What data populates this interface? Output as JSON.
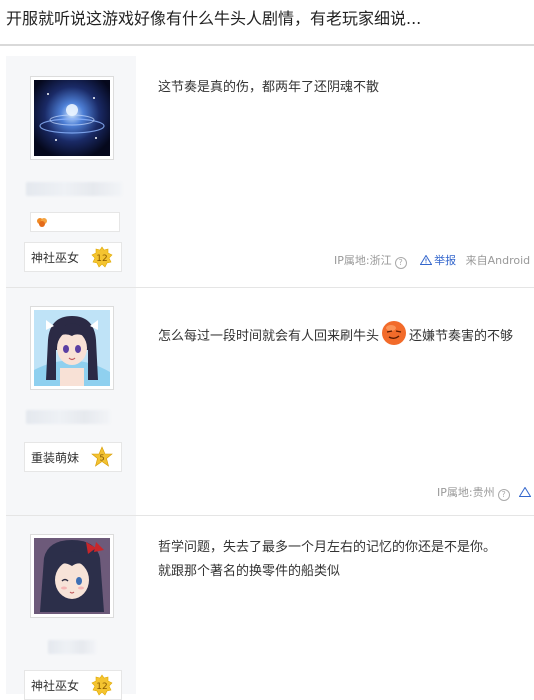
{
  "thread": {
    "title": "开服就听说这游戏好像有什么牛头人剧情，有老玩家细说..."
  },
  "posts": [
    {
      "avatar_icon": "galaxy-avatar-icon",
      "mini_badge_icon": "flower-icon",
      "level_title": "神社巫女",
      "level": "12",
      "content_lines": [
        "这节奏是真的伤，都两年了还阴魂不散"
      ],
      "ip_label": "IP属地:浙江",
      "report_label": "举报",
      "source_label": "来自Android"
    },
    {
      "avatar_icon": "anime-girl-avatar-icon",
      "level_title": "重装萌妹",
      "level": "5",
      "content_before": "怎么每过一段时间就会有人回来刷牛头",
      "emoji_icon": "smug-face-emoji-icon",
      "content_after": "还嫌节奏害的不够",
      "ip_label": "IP属地:贵州"
    },
    {
      "avatar_icon": "anime-girl-wink-avatar-icon",
      "level_title": "神社巫女",
      "level": "12",
      "content_lines": [
        "哲学问题，失去了最多一个月左右的记忆的你还是不是你。",
        "就跟那个著名的换零件的船类似"
      ]
    }
  ],
  "colors": {
    "level_badge": "#f4c430",
    "report_link": "#3366cc",
    "author_bg": "#f6f7f9"
  }
}
